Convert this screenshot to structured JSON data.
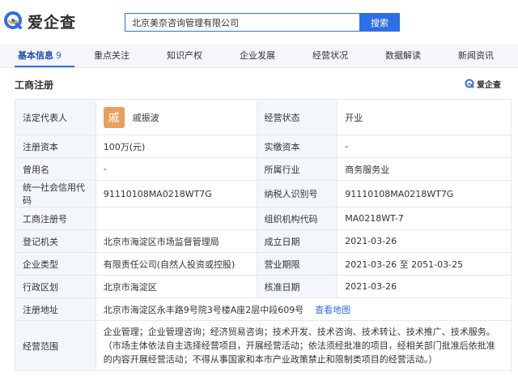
{
  "header": {
    "logo_text": "爱企查",
    "search_value": "北京美奈咨询管理有限公司",
    "search_button": "搜索"
  },
  "tabs": [
    {
      "label": "基本信息",
      "count": "9",
      "active": true
    },
    {
      "label": "重点关注"
    },
    {
      "label": "知识产权"
    },
    {
      "label": "企业发展"
    },
    {
      "label": "经营状况"
    },
    {
      "label": "数据解读"
    },
    {
      "label": "新闻资讯"
    }
  ],
  "section": {
    "title": "工商注册",
    "mini_logo_text": "爱企查"
  },
  "colors": {
    "accent": "#2e6fe8",
    "label_bg": "#f3f6fb",
    "avatar_bg": "#e8a05c"
  },
  "info": {
    "legal_rep_label": "法定代表人",
    "legal_rep_avatar": "戚",
    "legal_rep_name": "戚振波",
    "status_label": "经营状态",
    "status_value": "开业",
    "reg_capital_label": "注册资本",
    "reg_capital_value": "100万(元)",
    "paid_capital_label": "实缴资本",
    "paid_capital_value": "-",
    "former_name_label": "曾用名",
    "former_name_value": "-",
    "industry_label": "所属行业",
    "industry_value": "商务服务业",
    "credit_code_label": "统一社会信用代码",
    "credit_code_value": "91110108MA0218WT7G",
    "taxpayer_label": "纳税人识别号",
    "taxpayer_value": "91110108MA0218WT7G",
    "reg_no_label": "工商注册号",
    "reg_no_value": "",
    "org_code_label": "组织机构代码",
    "org_code_value": "MA0218WT-7",
    "authority_label": "登记机关",
    "authority_value": "北京市海淀区市场监督管理局",
    "founded_label": "成立日期",
    "founded_value": "2021-03-26",
    "type_label": "企业类型",
    "type_value": "有限责任公司(自然人投资或控股)",
    "term_label": "营业期限",
    "term_value": "2021-03-26 至 2051-03-25",
    "district_label": "行政区划",
    "district_value": "北京市海淀区",
    "approved_label": "核准日期",
    "approved_value": "2021-03-26",
    "address_label": "注册地址",
    "address_value": "北京市海淀区永丰路9号院3号楼A座2层中段609号",
    "map_link": "查看地图",
    "scope_label": "经营范围",
    "scope_value": "企业管理；企业管理咨询；经济贸易咨询；技术开发、技术咨询、技术转让、技术推广、技术服务。（市场主体依法自主选择经营项目，开展经营活动；依法须经批准的项目，经相关部门批准后依批准的内容开展经营活动；不得从事国家和本市产业政策禁止和限制类项目的经营活动。）"
  }
}
